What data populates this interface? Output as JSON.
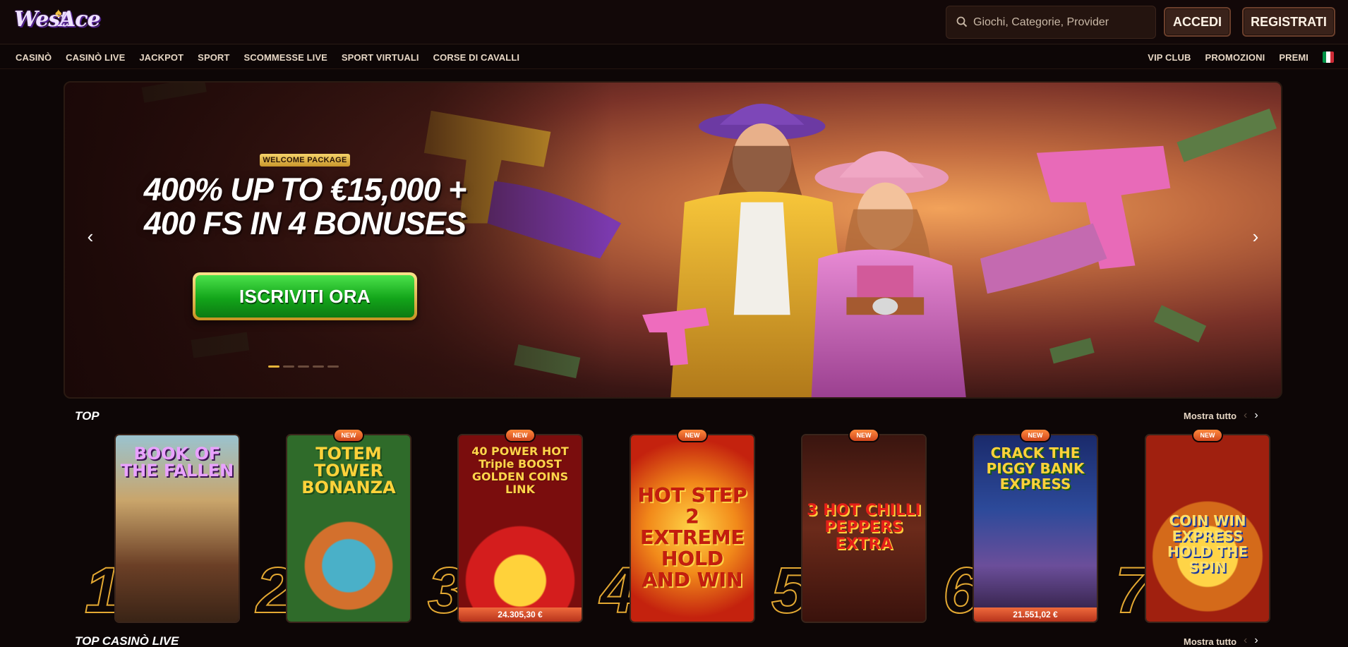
{
  "header": {
    "logo_text_west": "West",
    "logo_text_ace": "Ace",
    "search_placeholder": "Giochi, Categorie, Provider",
    "login_label": "ACCEDI",
    "register_label": "REGISTRATI"
  },
  "nav": {
    "left": [
      "CASINÒ",
      "CASINÒ LIVE",
      "JACKPOT",
      "SPORT",
      "SCOMMESSE LIVE",
      "SPORT VIRTUALI",
      "CORSE DI CAVALLI"
    ],
    "right": [
      "VIP CLUB",
      "PROMOZIONI",
      "PREMI"
    ],
    "flag_colors": [
      "#009246",
      "#ffffff",
      "#ce2b37"
    ]
  },
  "banner": {
    "badge": "WELCOME PACKAGE",
    "headline_line1": "400% UP TO €15,000 +",
    "headline_line2": "400 FS IN 4 BONUSES",
    "cta": "ISCRIVITI ORA",
    "slides": 5,
    "active_slide": 1
  },
  "top": {
    "title": "TOP",
    "show_all": "Mostra tutto",
    "games": [
      {
        "rank": "1",
        "title": "BOOK OF THE FALLEN",
        "new": false,
        "jackpot": ""
      },
      {
        "rank": "2",
        "title": "TOTEM TOWER BONANZA",
        "new": true,
        "jackpot": ""
      },
      {
        "rank": "3",
        "title": "40 POWER HOT Triple BOOST GOLDEN COINS LINK",
        "new": true,
        "jackpot": "24.305,30 €"
      },
      {
        "rank": "4",
        "title": "HOT STEP 2 EXTREME HOLD AND WIN",
        "new": true,
        "jackpot": ""
      },
      {
        "rank": "5",
        "title": "3 HOT CHILLI PEPPERS EXTRA",
        "new": true,
        "jackpot": ""
      },
      {
        "rank": "6",
        "title": "CRACK THE PIGGY BANK EXPRESS",
        "new": true,
        "jackpot": "21.551,02 €"
      },
      {
        "rank": "7",
        "title": "COIN WIN EXPRESS HOLD THE SPIN",
        "new": true,
        "jackpot": ""
      }
    ],
    "new_label": "NEW"
  },
  "live": {
    "title": "TOP CASINÒ LIVE",
    "show_all": "Mostra tutto"
  }
}
